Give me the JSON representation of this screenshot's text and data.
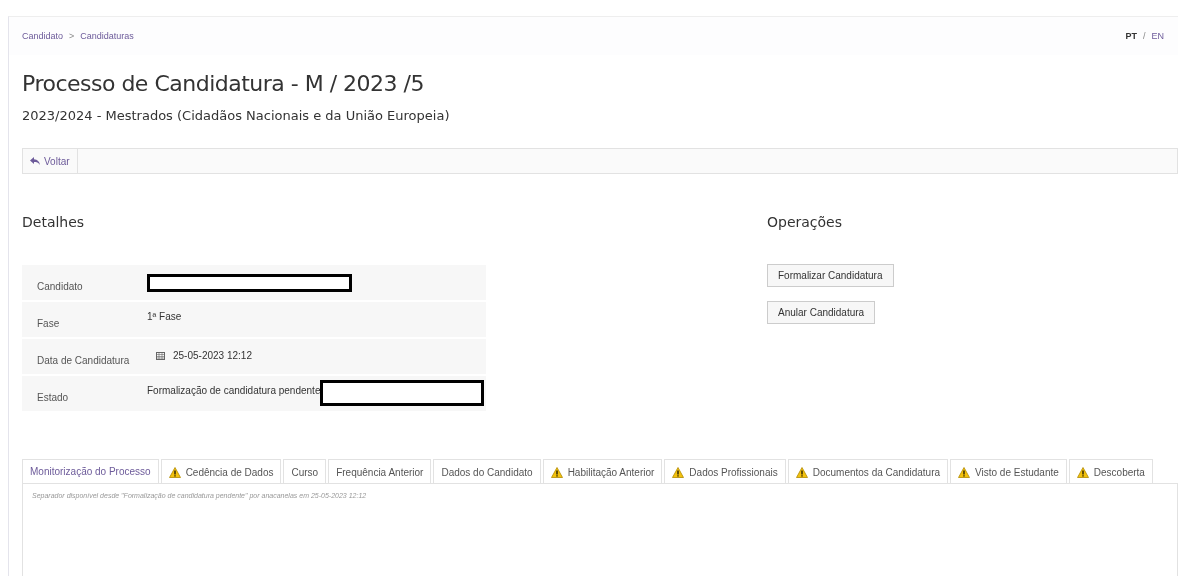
{
  "breadcrumb": [
    "Candidato",
    "Candidaturas"
  ],
  "breadcrumb_separator": ">",
  "languages": [
    {
      "label": "PT",
      "selected": true
    },
    {
      "label": "EN",
      "selected": false
    }
  ],
  "language_separator": "/",
  "title": "Processo de Candidatura - M / 2023 /5",
  "subtitle": "2023/2024 - Mestrados (Cidadãos Nacionais e da União Europeia)",
  "back_button": "Voltar",
  "details": {
    "heading": "Detalhes",
    "rows": [
      {
        "label": "Candidato",
        "value": "",
        "kind": "redacted"
      },
      {
        "label": "Fase",
        "value": "1ª Fase",
        "kind": "text"
      },
      {
        "label": "Data de Candidatura",
        "value": "25-05-2023 12:12",
        "kind": "date"
      },
      {
        "label": "Estado",
        "value": "Formalização de candidatura pendente",
        "kind": "text_redacted"
      }
    ]
  },
  "operations": {
    "heading": "Operações",
    "buttons": [
      "Formalizar Candidatura",
      "Anular Candidatura"
    ]
  },
  "tabs": [
    {
      "label": "Monitorização do Processo",
      "selected": true,
      "warning": false
    },
    {
      "label": "Cedência de Dados",
      "selected": false,
      "warning": true
    },
    {
      "label": "Curso",
      "selected": false,
      "warning": false
    },
    {
      "label": "Frequência Anterior",
      "selected": false,
      "warning": false
    },
    {
      "label": "Dados do Candidato",
      "selected": false,
      "warning": false
    },
    {
      "label": "Habilitação Anterior",
      "selected": false,
      "warning": true
    },
    {
      "label": "Dados Profissionais",
      "selected": false,
      "warning": true
    },
    {
      "label": "Documentos da Candidatura",
      "selected": false,
      "warning": true
    },
    {
      "label": "Visto de Estudante",
      "selected": false,
      "warning": true
    },
    {
      "label": "Descoberta",
      "selected": false,
      "warning": true
    }
  ],
  "tab_note": "Separador disponível desde \"Formalização de candidatura pendente\" por anacanelas em 25-05-2023 12:12"
}
